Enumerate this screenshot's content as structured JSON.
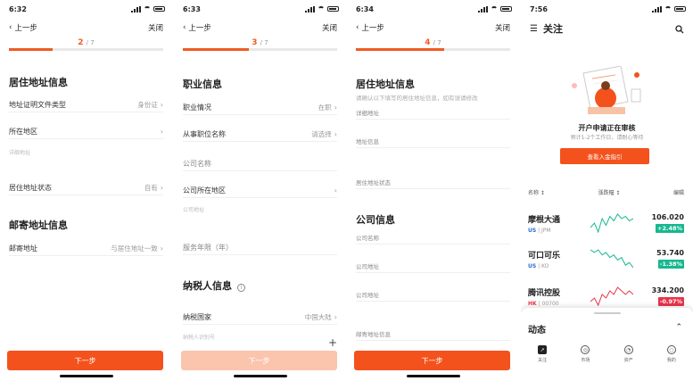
{
  "colors": {
    "accent": "#f4521d",
    "up_green": "#17b890",
    "down_red": "#e8334a"
  },
  "phones": [
    {
      "time": "6:32",
      "back": "上一步",
      "close": "关闭",
      "step": "2",
      "total": "/ 7",
      "progress": 0.285,
      "section1": "居住地址信息",
      "rows": [
        {
          "label": "地址证明文件类型",
          "value": "身份证"
        },
        {
          "label": "所在地区",
          "value": ""
        },
        {
          "label": "居住地址状态",
          "value": "自有"
        }
      ],
      "hint": "详细地址",
      "section2": "邮寄地址信息",
      "mail": {
        "label": "邮寄地址",
        "value": "与居住地址一致"
      },
      "button": "下一步"
    },
    {
      "time": "6:33",
      "back": "上一步",
      "close": "关闭",
      "step": "3",
      "total": "/ 7",
      "progress": 0.43,
      "section1": "职业信息",
      "rows": [
        {
          "label": "职业情况",
          "value": "在职"
        },
        {
          "label": "从事职位名称",
          "value": "请选择"
        },
        {
          "label": "公司名称",
          "value": ""
        },
        {
          "label": "公司所在地区",
          "value": ""
        },
        {
          "label": "服务年限（年）",
          "value": ""
        }
      ],
      "hint": "公司地址",
      "section2": "纳税人信息",
      "tax": [
        {
          "label": "纳税国家",
          "value": "中国大陆"
        },
        {
          "label": "纳税人识别号",
          "value": ""
        }
      ],
      "button": "下一步"
    },
    {
      "time": "6:34",
      "back": "上一步",
      "close": "关闭",
      "step": "4",
      "total": "/ 7",
      "progress": 0.57,
      "section1": "居住地址信息",
      "desc": "请确认以下填写的居住地址信息，如有误请修改",
      "rows": [
        {
          "label": "详细地址"
        },
        {
          "label": "地址信息"
        },
        {
          "label": "居住地址状态"
        }
      ],
      "section2": "公司信息",
      "rows2": [
        {
          "label": "公司名称"
        },
        {
          "label": "公司地址"
        },
        {
          "label": "公司地址"
        },
        {
          "label": "邮寄地址信息"
        }
      ],
      "button": "下一步"
    }
  ],
  "watchlist": {
    "time": "7:56",
    "title": "关注",
    "card_title": "开户申请正在审核",
    "card_sub": "预计1-2个工作日，请耐心等待",
    "card_button": "查看入金指引",
    "columns": [
      "名称 ↕",
      "涨跌幅 ↕",
      "编辑"
    ],
    "stocks": [
      {
        "name": "摩根大通",
        "market": "US",
        "code": "JPM",
        "price": "106.020",
        "change": "+2.48%",
        "trend": [
          8,
          6,
          10,
          4,
          7,
          3,
          5,
          2,
          4,
          3,
          5,
          4
        ]
      },
      {
        "name": "可口可乐",
        "market": "US",
        "code": "KO",
        "price": "53.740",
        "change": "-1.38%",
        "trend": [
          3,
          4,
          3,
          5,
          4,
          6,
          5,
          7,
          6,
          9,
          8,
          10
        ]
      },
      {
        "name": "腾讯控股",
        "market": "HK",
        "code": "00700",
        "price": "334.200",
        "change": "-0.97%",
        "trend": [
          8,
          7,
          9,
          6,
          7,
          5,
          6,
          4,
          5,
          6,
          5,
          6
        ]
      }
    ],
    "sheet_title": "动态",
    "tabs": [
      {
        "label": "关注",
        "icon": "chart-icon"
      },
      {
        "label": "市场",
        "icon": "market-icon"
      },
      {
        "label": "资产",
        "icon": "asset-icon"
      },
      {
        "label": "我的",
        "icon": "profile-icon"
      }
    ]
  }
}
